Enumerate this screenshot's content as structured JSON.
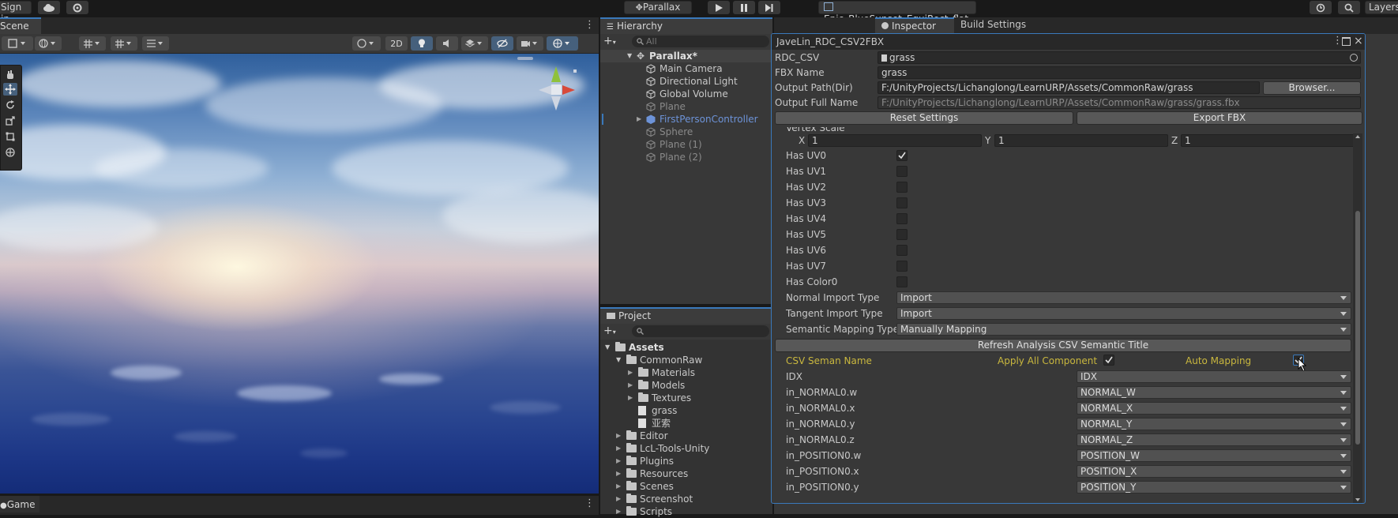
{
  "topbar": {
    "sign_in": "Sign in",
    "parallax_label": "Parallax",
    "skybox_label": "Epic_BlueSunset_EquiRect_flat",
    "layers_label": "Layers"
  },
  "scene": {
    "tab": "Scene",
    "btn_2d": "2D",
    "game_tab": "Game"
  },
  "hierarchy": {
    "tab": "Hierarchy",
    "search_placeholder": "All",
    "root": "Parallax*",
    "items": [
      {
        "label": "Main Camera"
      },
      {
        "label": "Directional Light"
      },
      {
        "label": "Global Volume"
      },
      {
        "label": "Plane"
      },
      {
        "label": "FirstPersonController"
      },
      {
        "label": "Sphere"
      },
      {
        "label": "Plane (1)"
      },
      {
        "label": "Plane (2)"
      }
    ]
  },
  "project": {
    "tab": "Project",
    "assets": "Assets",
    "items": [
      {
        "label": "CommonRaw"
      },
      {
        "label": "Materials"
      },
      {
        "label": "Models"
      },
      {
        "label": "Textures"
      },
      {
        "label": "grass"
      },
      {
        "label": "亚索"
      },
      {
        "label": "Editor"
      },
      {
        "label": "LcL-Tools-Unity"
      },
      {
        "label": "Plugins"
      },
      {
        "label": "Resources"
      },
      {
        "label": "Scenes"
      },
      {
        "label": "Screenshot"
      },
      {
        "label": "Scripts"
      }
    ]
  },
  "inspector": {
    "tab": "Inspector",
    "build_settings_tab": "Build Settings"
  },
  "window": {
    "title": "JaveLin_RDC_CSV2FBX",
    "rdc_csv_label": "RDC_CSV",
    "rdc_csv_value": "grass",
    "fbx_name_label": "FBX Name",
    "fbx_name_value": "grass",
    "output_path_label": "Output Path(Dir)",
    "output_path_value": "F:/UnityProjects/Lichanglong/LearnURP/Assets/CommonRaw/grass",
    "browser_button": "Browser...",
    "output_full_label": "Output Full Name",
    "output_full_value": "F:/UnityProjects/Lichanglong/LearnURP/Assets/CommonRaw/grass/grass.fbx",
    "reset_button": "Reset Settings",
    "export_button": "Export FBX",
    "vertex_scale_label": "Vertex Scale",
    "vertex_scale": {
      "x_label": "X",
      "x": "1",
      "y_label": "Y",
      "y": "1",
      "z_label": "Z",
      "z": "1"
    },
    "has_flags": [
      {
        "label": "Has UV0",
        "checked": true
      },
      {
        "label": "Has UV1",
        "checked": false
      },
      {
        "label": "Has UV2",
        "checked": false
      },
      {
        "label": "Has UV3",
        "checked": false
      },
      {
        "label": "Has UV4",
        "checked": false
      },
      {
        "label": "Has UV5",
        "checked": false
      },
      {
        "label": "Has UV6",
        "checked": false
      },
      {
        "label": "Has UV7",
        "checked": false
      },
      {
        "label": "Has Color0",
        "checked": false
      }
    ],
    "normal_import_label": "Normal Import Type",
    "normal_import_value": "Import",
    "tangent_import_label": "Tangent Import Type",
    "tangent_import_value": "Import",
    "semantic_mapping_label": "Semantic Mapping Type",
    "semantic_mapping_value": "Manually Mapping",
    "refresh_button": "Refresh Analysis CSV Semantic Title",
    "csv_seman_name": "CSV Seman Name",
    "apply_all_component": "Apply All Component",
    "auto_mapping": "Auto Mapping",
    "mappings": [
      {
        "name": "IDX",
        "value": "IDX"
      },
      {
        "name": "in_NORMAL0.w",
        "value": "NORMAL_W"
      },
      {
        "name": "in_NORMAL0.x",
        "value": "NORMAL_X"
      },
      {
        "name": "in_NORMAL0.y",
        "value": "NORMAL_Y"
      },
      {
        "name": "in_NORMAL0.z",
        "value": "NORMAL_Z"
      },
      {
        "name": "in_POSITION0.w",
        "value": "POSITION_W"
      },
      {
        "name": "in_POSITION0.x",
        "value": "POSITION_X"
      },
      {
        "name": "in_POSITION0.y",
        "value": "POSITION_Y"
      }
    ]
  },
  "colors": {
    "accent_blue": "#3a79bb",
    "label_yellow": "#c9b73e",
    "prefab_blue": "#6d93d8"
  }
}
